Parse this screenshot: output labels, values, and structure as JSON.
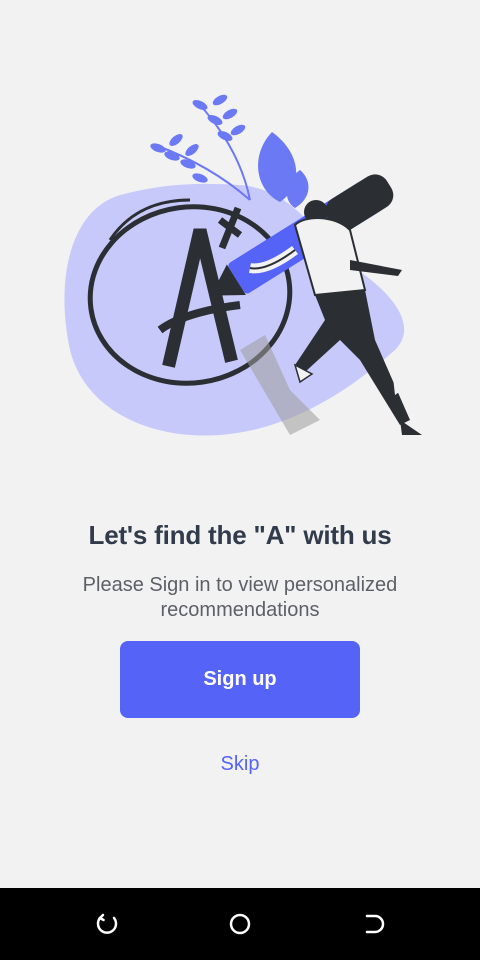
{
  "onboarding": {
    "title": "Let's find the \"A\" with us",
    "subtitle": "Please Sign in to view personalized recommendations",
    "signup_label": "Sign up",
    "skip_label": "Skip"
  },
  "illustration": {
    "icon": "person-with-pencil-grade-a-plus-illustration"
  },
  "navbar": {
    "buttons": [
      "recent-apps-icon",
      "home-icon",
      "back-icon"
    ]
  },
  "colors": {
    "background": "#f2f2f2",
    "accent": "#5563f7",
    "title": "#323b4b",
    "subtitle": "#5d6066",
    "navbar": "#000000"
  }
}
